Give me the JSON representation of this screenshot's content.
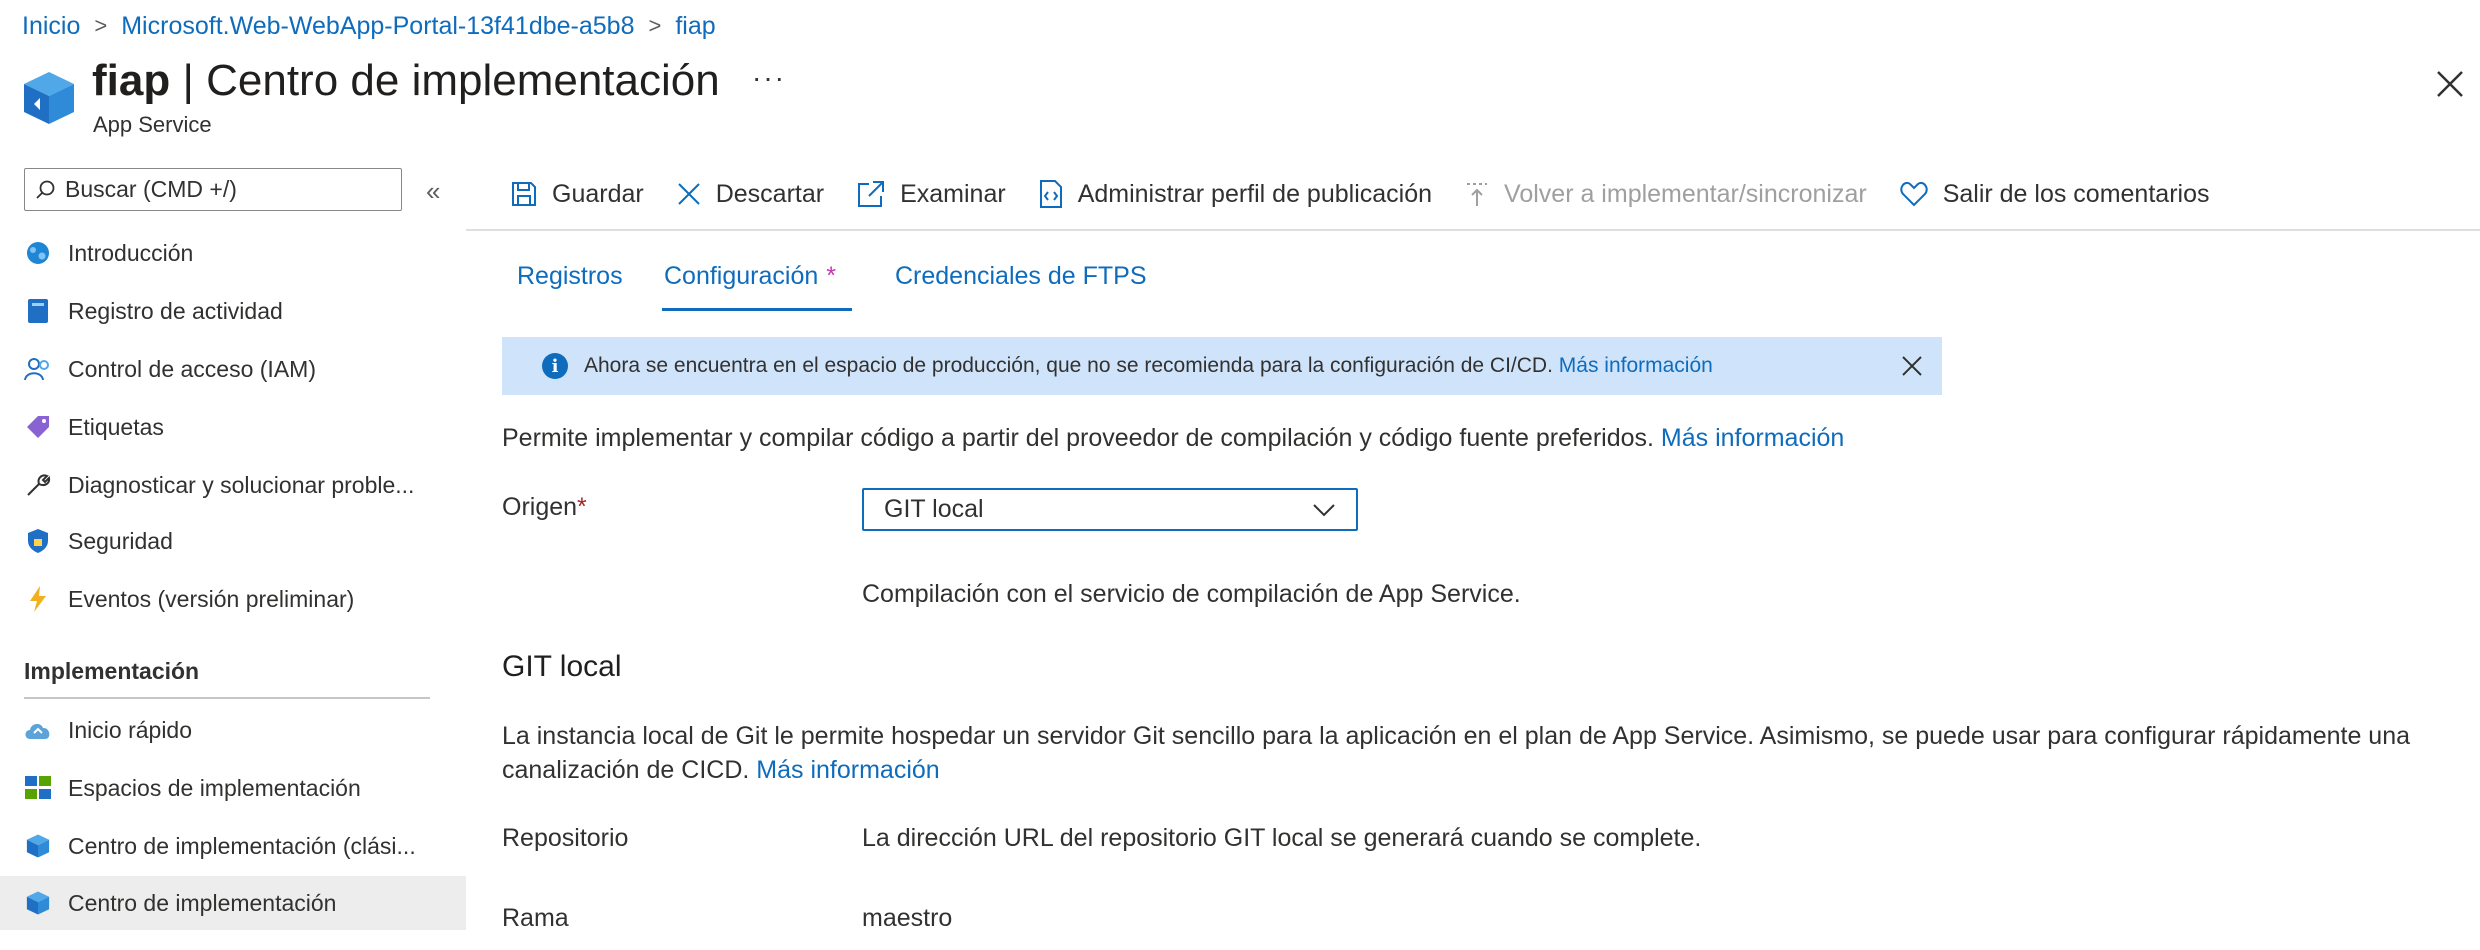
{
  "breadcrumb": {
    "items": [
      "Inicio",
      "Microsoft.Web-WebApp-Portal-13f41dbe-a5b8",
      "fiap"
    ]
  },
  "header": {
    "resource_name": "fiap",
    "title_rest": " | Centro de implementación",
    "subtitle": "App Service",
    "more": "···"
  },
  "sidebar": {
    "search_placeholder": "Buscar (CMD +/)",
    "collapse": "«",
    "items": [
      {
        "label": "Introducción"
      },
      {
        "label": "Registro de actividad"
      },
      {
        "label": "Control de acceso (IAM)"
      },
      {
        "label": "Etiquetas"
      },
      {
        "label": "Diagnosticar y solucionar proble..."
      },
      {
        "label": "Seguridad"
      },
      {
        "label": "Eventos (versión preliminar)"
      }
    ],
    "section": "Implementación",
    "section_items": [
      {
        "label": "Inicio rápido"
      },
      {
        "label": "Espacios de implementación"
      },
      {
        "label": "Centro de implementación (clási..."
      },
      {
        "label": "Centro de implementación",
        "active": true
      }
    ]
  },
  "toolbar": {
    "save": "Guardar",
    "discard": "Descartar",
    "browse": "Examinar",
    "manage_profile": "Administrar perfil de publicación",
    "redeploy": "Volver a implementar/sincronizar",
    "feedback": "Salir de los comentarios"
  },
  "tabs": {
    "logs": "Registros",
    "settings": "Configuración",
    "settings_marker": "*",
    "ftps": "Credenciales de FTPS"
  },
  "banner": {
    "text": "Ahora se encuentra en el espacio de producción, que no se recomienda para la configuración de CI/CD.",
    "link": "Más información"
  },
  "content": {
    "intro": "Permite implementar y compilar código a partir del proveedor de compilación y código fuente preferidos.",
    "intro_link": "Más información",
    "source_label": "Origen",
    "required_marker": "*",
    "source_value": "GIT local",
    "build_text": "Compilación con el servicio de compilación de App Service.",
    "git_heading": "GIT local",
    "git_desc_line1": "La instancia local de Git le permite hospedar un servidor Git sencillo para la aplicación en el plan de App Service. Asimismo, se puede usar para configurar rápidamente una",
    "git_desc_line2": "canalización de CICD.",
    "git_desc_link": "Más información",
    "repo_label": "Repositorio",
    "repo_value": "La dirección URL del repositorio GIT local se generará cuando se complete.",
    "branch_label": "Rama",
    "branch_value": "maestro"
  },
  "colors": {
    "accent": "#0f6cbd",
    "banner_bg": "#cfe4fa",
    "required": "#a4262c",
    "tab_marker": "#c239b3",
    "active_nav_bg": "#ededed"
  }
}
